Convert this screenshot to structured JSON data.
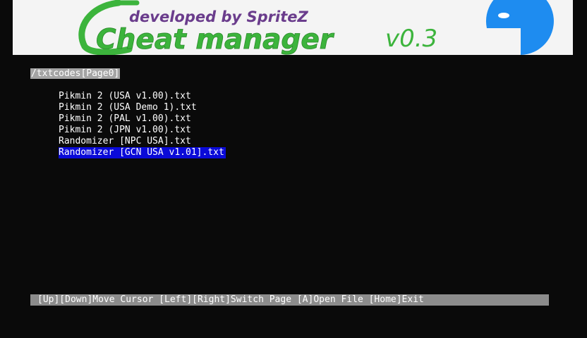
{
  "banner": {
    "title": "Cheat manager",
    "version": "v0.3",
    "credit": "developed by SpriteZ",
    "colors": {
      "title_green": "#3cb43c",
      "credit_purple": "#6a3c8c",
      "pacman_blue": "#1e8cf0",
      "background": "#f4f4f4"
    },
    "logo_icon": "pacman-icon"
  },
  "browser": {
    "path": "/txtcodes[Page0]",
    "files": [
      {
        "name": "Pikmin 2 (USA v1.00).txt",
        "selected": false
      },
      {
        "name": "Pikmin 2 (USA Demo 1).txt",
        "selected": false
      },
      {
        "name": "Pikmin 2 (PAL v1.00).txt",
        "selected": false
      },
      {
        "name": "Pikmin 2 (JPN v1.00).txt",
        "selected": false
      },
      {
        "name": "Randomizer [NPC USA].txt",
        "selected": false
      },
      {
        "name": "Randomizer [GCN USA v1.01].txt",
        "selected": true
      }
    ],
    "selection_color": "#0a0ad8"
  },
  "help": {
    "text": "[Up][Down]Move Cursor [Left][Right]Switch Page [A]Open File [Home]Exit"
  }
}
